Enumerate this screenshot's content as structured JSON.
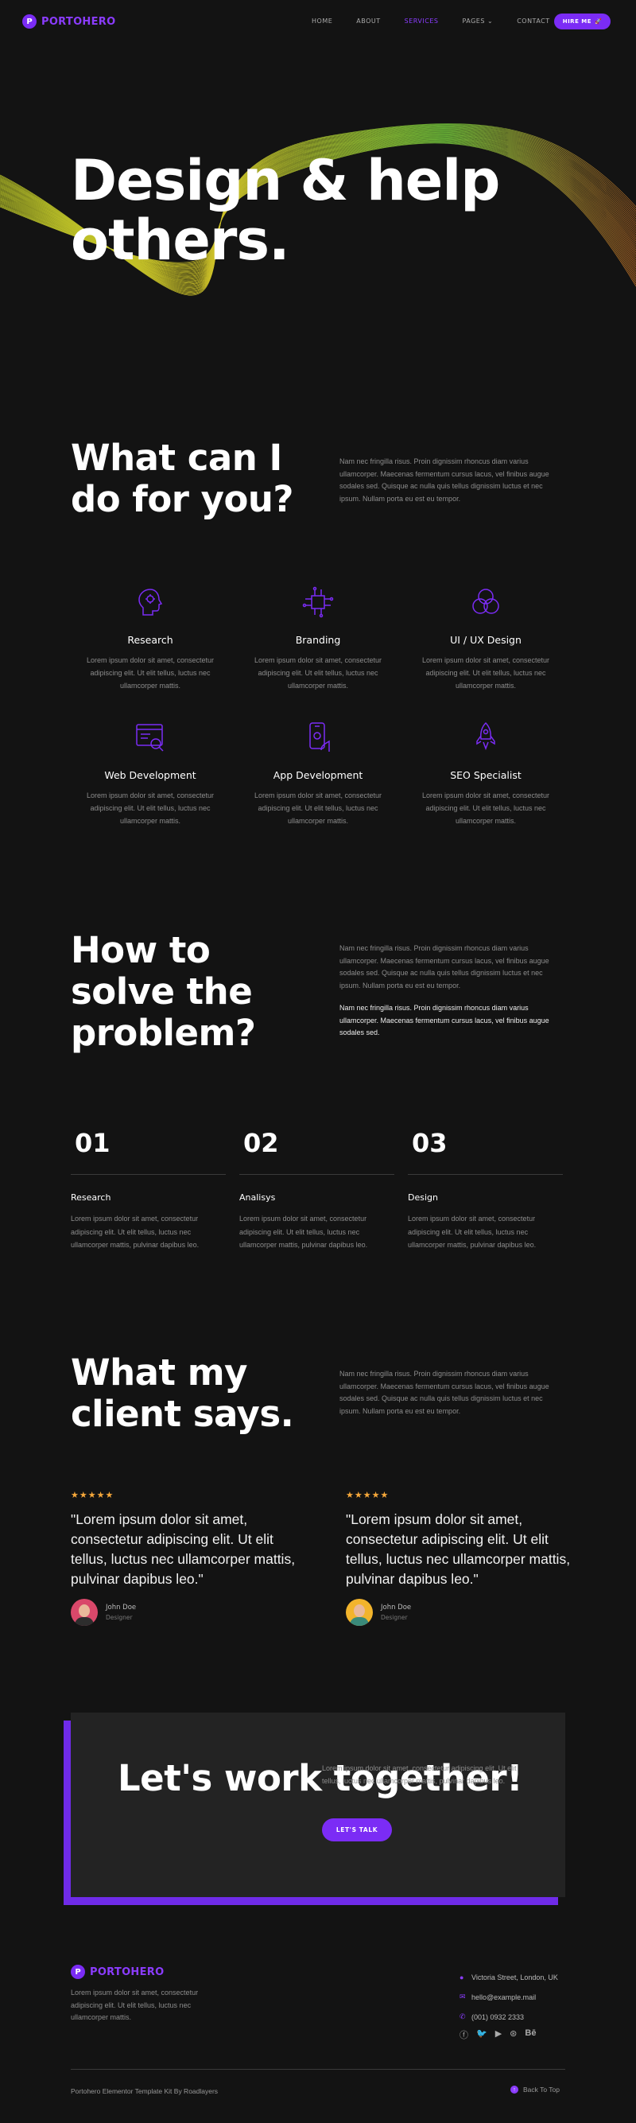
{
  "header": {
    "logo_letter": "P",
    "logo_text": "PORTOHERO",
    "nav": [
      {
        "label": "HOME"
      },
      {
        "label": "ABOUT"
      },
      {
        "label": "SERVICES",
        "active": true
      },
      {
        "label": "PAGES ⌄"
      },
      {
        "label": "CONTACT"
      }
    ],
    "hire_label": "HIRE ME",
    "hire_icon": "rocket-icon"
  },
  "hero": {
    "title": "Design & help others."
  },
  "services": {
    "title": "What can I do for you?",
    "intro": "Nam nec fringilla risus. Proin dignissim rhoncus diam varius ullamcorper. Maecenas fermentum cursus lacus, vel finibus augue sodales sed. Quisque ac nulla quis tellus dignissim luctus et nec ipsum. Nullam porta eu est eu tempor.",
    "items": [
      {
        "icon": "brain-icon",
        "title": "Research",
        "text": "Lorem ipsum dolor sit amet, consectetur adipiscing elit. Ut elit tellus, luctus nec ullamcorper mattis."
      },
      {
        "icon": "circuit-icon",
        "title": "Branding",
        "text": "Lorem ipsum dolor sit amet, consectetur adipiscing elit. Ut elit tellus, luctus nec ullamcorper mattis."
      },
      {
        "icon": "color-circles-icon",
        "title": "UI / UX Design",
        "text": "Lorem ipsum dolor sit amet, consectetur adipiscing elit. Ut elit tellus, luctus nec ullamcorper mattis."
      },
      {
        "icon": "browser-search-icon",
        "title": "Web Development",
        "text": "Lorem ipsum dolor sit amet, consectetur adipiscing elit. Ut elit tellus, luctus nec ullamcorper mattis."
      },
      {
        "icon": "mobile-hand-icon",
        "title": "App Development",
        "text": "Lorem ipsum dolor sit amet, consectetur adipiscing elit. Ut elit tellus, luctus nec ullamcorper mattis."
      },
      {
        "icon": "rocket-icon",
        "title": "SEO Specialist",
        "text": "Lorem ipsum dolor sit amet, consectetur adipiscing elit. Ut elit tellus, luctus nec ullamcorper mattis."
      }
    ]
  },
  "problem": {
    "title": "How to solve the problem?",
    "intro": "Nam nec fringilla risus. Proin dignissim rhoncus diam varius ullamcorper. Maecenas fermentum cursus lacus, vel finibus augue sodales sed. Quisque ac nulla quis tellus dignissim luctus et nec ipsum. Nullam porta eu est eu tempor.",
    "highlight": "Nam nec fringilla risus. Proin dignissim rhoncus diam varius ullamcorper. Maecenas fermentum cursus lacus, vel finibus augue sodales sed.",
    "steps": [
      {
        "num": "01",
        "title": "Research",
        "text": "Lorem ipsum dolor sit amet, consectetur adipiscing elit. Ut elit tellus, luctus nec ullamcorper mattis, pulvinar dapibus leo."
      },
      {
        "num": "02",
        "title": "Analisys",
        "text": "Lorem ipsum dolor sit amet, consectetur adipiscing elit. Ut elit tellus, luctus nec ullamcorper mattis, pulvinar dapibus leo."
      },
      {
        "num": "03",
        "title": "Design",
        "text": "Lorem ipsum dolor sit amet, consectetur adipiscing elit. Ut elit tellus, luctus nec ullamcorper mattis, pulvinar dapibus leo."
      }
    ]
  },
  "clients": {
    "title": "What my client says.",
    "intro": "Nam nec fringilla risus. Proin dignissim rhoncus diam varius ullamcorper. Maecenas fermentum cursus lacus, vel finibus augue sodales sed. Quisque ac nulla quis tellus dignissim luctus et nec ipsum. Nullam porta eu est eu tempor.",
    "testimonials": [
      {
        "stars": "★★★★★",
        "rating": 5,
        "quote": "\"Lorem ipsum dolor sit amet, consectetur adipiscing elit. Ut elit tellus, luctus nec ullamcorper mattis, pulvinar dapibus leo.\"",
        "name": "John Doe",
        "role": "Designer",
        "avatar_bg": "#d9486a",
        "shirt": "#2d2d2d"
      },
      {
        "stars": "★★★★★",
        "rating": 5,
        "quote": "\"Lorem ipsum dolor sit amet, consectetur adipiscing elit. Ut elit tellus, luctus nec ullamcorper mattis, pulvinar dapibus leo.\"",
        "name": "John Doe",
        "role": "Designer",
        "avatar_bg": "#f2b42c",
        "shirt": "#3a8a7a"
      }
    ]
  },
  "cta": {
    "title": "Let's work together!",
    "text": "Lorem ipsum dolor sit amet, consectetur adipiscing elit. Ut elit tellus, luctus nec ullamcorper mattis, pulvinar dapibus leo.",
    "button": "LET'S TALK"
  },
  "footer": {
    "logo_letter": "P",
    "logo_text": "PORTOHERO",
    "about": "Lorem ipsum dolor sit amet, consectetur adipiscing elit. Ut elit tellus, luctus nec ullamcorper mattis.",
    "address": "Victoria Street, London, UK",
    "email": "hello@example.mail",
    "phone": "(001) 0932 2333",
    "social_icons": [
      "facebook-icon",
      "twitter-icon",
      "youtube-icon",
      "dribbble-icon",
      "behance-icon"
    ],
    "copyright": "Portohero Elementor Template Kit By Roadlayers",
    "back_to_top": "Back To Top"
  },
  "colors": {
    "accent": "#7b2cf5",
    "background": "#131313",
    "star": "#f7a83a"
  }
}
